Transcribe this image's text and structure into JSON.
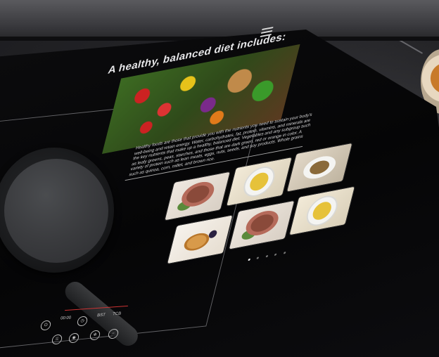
{
  "display": {
    "title": "A healthy, balanced diet includes:",
    "body": "Healthy foods are those that provide you with the nutrients you need to sustain your body's well-being and retain energy. Water, carbohydrates, fat, protein, vitamins, and minerals are the key nutrients that make up a healthy, balanced diet. Vegetables and any subgroup such as leafy greens, peas, starches, and those that are dark green, red or orange in color. A variety of protein such as lean meats, eggs, nuts, seeds, and soy products. Whole grains such as quinoa, corn, millet, and brown rice.",
    "menu_icon": "hamburger-menu-icon",
    "hero_image": "vegetables-assortment-image",
    "gallery": [
      {
        "name": "grilled-steak-image"
      },
      {
        "name": "rice-dish-image"
      },
      {
        "name": "pasta-dish-image"
      },
      {
        "name": "grilled-steak-image"
      },
      {
        "name": "rice-dish-image"
      },
      {
        "name": "pancakes-image"
      }
    ],
    "pagination": {
      "count": 5,
      "active": 0
    }
  },
  "control_panel": {
    "timer": "00:00",
    "labels": [
      "BST",
      "TCB"
    ],
    "buttons": [
      "power-icon",
      "timer-icon",
      "lock-icon",
      "boost-icon",
      "fan-icon"
    ]
  },
  "colors": {
    "glass": "#050506",
    "slider": "#cc3333",
    "text": "#e8e8ea"
  }
}
